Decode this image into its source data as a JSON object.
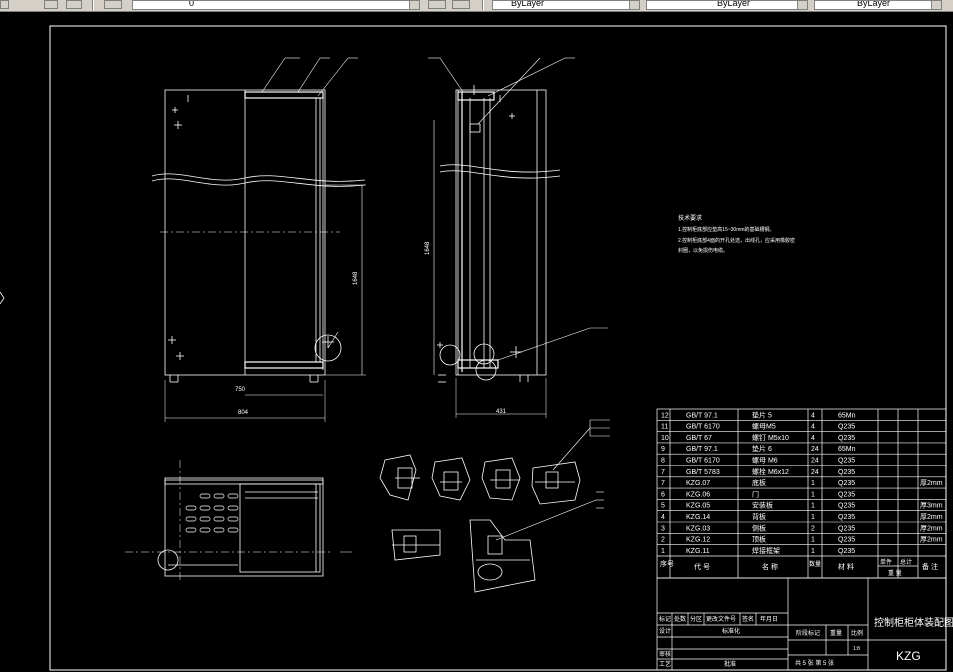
{
  "toolbar": {
    "color_control": "ByLayer",
    "linetype_control": "ByLayer",
    "lineweight_control": "ByLayer",
    "layer_value": "0"
  },
  "drawing": {
    "tech_req": {
      "title": "技术要求",
      "line1": "1.控制柜底部应垫高15~30mm的基础槽钢。",
      "line2": "2.控制柜底部4面的开孔处选，出线孔，应采用橡胶密",
      "line3": "封圈，以免损伤电缆。"
    },
    "dims": {
      "width_front": "750",
      "width_total": "804",
      "depth": "431",
      "height": "1648",
      "height_side": "1648"
    },
    "bom": [
      {
        "no": "12",
        "code": "GB/T 97.1",
        "name": "垫片 5",
        "qty": "4",
        "mat": "65Mn",
        "note": ""
      },
      {
        "no": "11",
        "code": "GB/T 6170",
        "name": "螺母M5",
        "qty": "4",
        "mat": "Q235",
        "note": ""
      },
      {
        "no": "10",
        "code": "GB/T 67",
        "name": "螺钉 M5x10",
        "qty": "4",
        "mat": "Q235",
        "note": ""
      },
      {
        "no": "9",
        "code": "GB/T 97.1",
        "name": "垫片 6",
        "qty": "24",
        "mat": "65Mn",
        "note": ""
      },
      {
        "no": "8",
        "code": "GB/T 6170",
        "name": "螺母 M6",
        "qty": "24",
        "mat": "Q235",
        "note": ""
      },
      {
        "no": "7",
        "code": "GB/T 5783",
        "name": "螺栓 M6x12",
        "qty": "24",
        "mat": "Q235",
        "note": ""
      },
      {
        "no": "7",
        "code": "KZG.07",
        "name": "底板",
        "qty": "1",
        "mat": "Q235",
        "note": "厚2mm"
      },
      {
        "no": "6",
        "code": "KZG.06",
        "name": "门",
        "qty": "1",
        "mat": "Q235",
        "note": ""
      },
      {
        "no": "5",
        "code": "KZG.05",
        "name": "安装板",
        "qty": "1",
        "mat": "Q235",
        "note": "厚3mm"
      },
      {
        "no": "4",
        "code": "KZG.14",
        "name": "背板",
        "qty": "1",
        "mat": "Q235",
        "note": "厚2mm"
      },
      {
        "no": "3",
        "code": "KZG.03",
        "name": "侧板",
        "qty": "2",
        "mat": "Q235",
        "note": "厚2mm"
      },
      {
        "no": "2",
        "code": "KZG.12",
        "name": "顶板",
        "qty": "1",
        "mat": "Q235",
        "note": "厚2mm"
      },
      {
        "no": "1",
        "code": "KZG.11",
        "name": "焊接框架",
        "qty": "1",
        "mat": "Q235",
        "note": ""
      }
    ],
    "bom_header": {
      "no": "序号",
      "code": "代 号",
      "name": "名 称",
      "qty": "数量",
      "mat": "材 料",
      "single": "单件",
      "total": "总计",
      "weight": "重 量",
      "note": "备 注"
    },
    "title_block": {
      "title": "控制柜柜体装配图",
      "code": "KZG",
      "r1": [
        "标记",
        "处数",
        "分区",
        "更改文件号",
        "签名",
        "年月日"
      ],
      "design": "设计",
      "std": "标准化",
      "stage": "阶段标记",
      "weight": "重量",
      "scale": "比例",
      "scale_val": "1:8",
      "sheet": "共 5 张 第 5 张",
      "review": "审核",
      "process": "工艺",
      "approve": "批准"
    }
  }
}
